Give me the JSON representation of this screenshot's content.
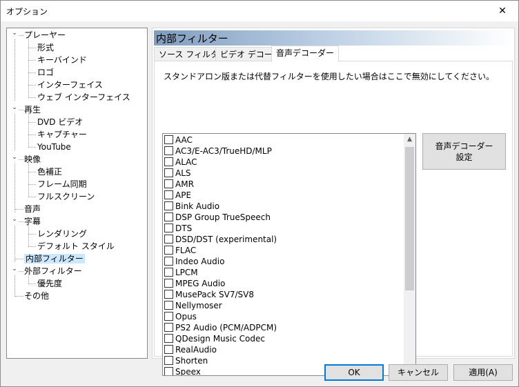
{
  "window": {
    "title": "オプション",
    "close_glyph": "✕"
  },
  "tree": {
    "items": [
      {
        "label": "プレーヤー",
        "level": 0,
        "expanded": true
      },
      {
        "label": "形式",
        "level": 1
      },
      {
        "label": "キーバインド",
        "level": 1
      },
      {
        "label": "ロゴ",
        "level": 1
      },
      {
        "label": "インターフェイス",
        "level": 1
      },
      {
        "label": "ウェブ インターフェイス",
        "level": 1
      },
      {
        "label": "再生",
        "level": 0,
        "expanded": true
      },
      {
        "label": "DVD ビデオ",
        "level": 1
      },
      {
        "label": "キャプチャー",
        "level": 1
      },
      {
        "label": "YouTube",
        "level": 1
      },
      {
        "label": "映像",
        "level": 0,
        "expanded": true
      },
      {
        "label": "色補正",
        "level": 1
      },
      {
        "label": "フレーム同期",
        "level": 1
      },
      {
        "label": "フルスクリーン",
        "level": 1
      },
      {
        "label": "音声",
        "level": 0
      },
      {
        "label": "字幕",
        "level": 0,
        "expanded": true
      },
      {
        "label": "レンダリング",
        "level": 1
      },
      {
        "label": "デフォルト スタイル",
        "level": 1
      },
      {
        "label": "内部フィルター",
        "level": 0,
        "selected": true
      },
      {
        "label": "外部フィルター",
        "level": 0,
        "expanded": true
      },
      {
        "label": "優先度",
        "level": 1
      },
      {
        "label": "その他",
        "level": 0
      }
    ]
  },
  "pane": {
    "header": "内部フィルター",
    "tabs": [
      {
        "label": "ソース フィルター",
        "active": false
      },
      {
        "label": "ビデオ デコーダー",
        "active": false
      },
      {
        "label": "音声デコーダー",
        "active": true
      }
    ],
    "description": "スタンドアロン版または代替フィルターを使用したい場合はここで無効にしてください。",
    "decoders": [
      "AAC",
      "AC3/E-AC3/TrueHD/MLP",
      "ALAC",
      "ALS",
      "AMR",
      "APE",
      "Bink Audio",
      "DSP Group TrueSpeech",
      "DTS",
      "DSD/DST (experimental)",
      "FLAC",
      "Indeo Audio",
      "LPCM",
      "MPEG Audio",
      "MusePack SV7/SV8",
      "Nellymoser",
      "Opus",
      "PS2 Audio (PCM/ADPCM)",
      "QDesign Music Codec",
      "RealAudio",
      "Shorten",
      "Speex"
    ],
    "config_button_line1": "音声デコーダー",
    "config_button_line2": "設定"
  },
  "buttons": {
    "ok": "OK",
    "cancel": "キャンセル",
    "apply": "適用(A)"
  }
}
